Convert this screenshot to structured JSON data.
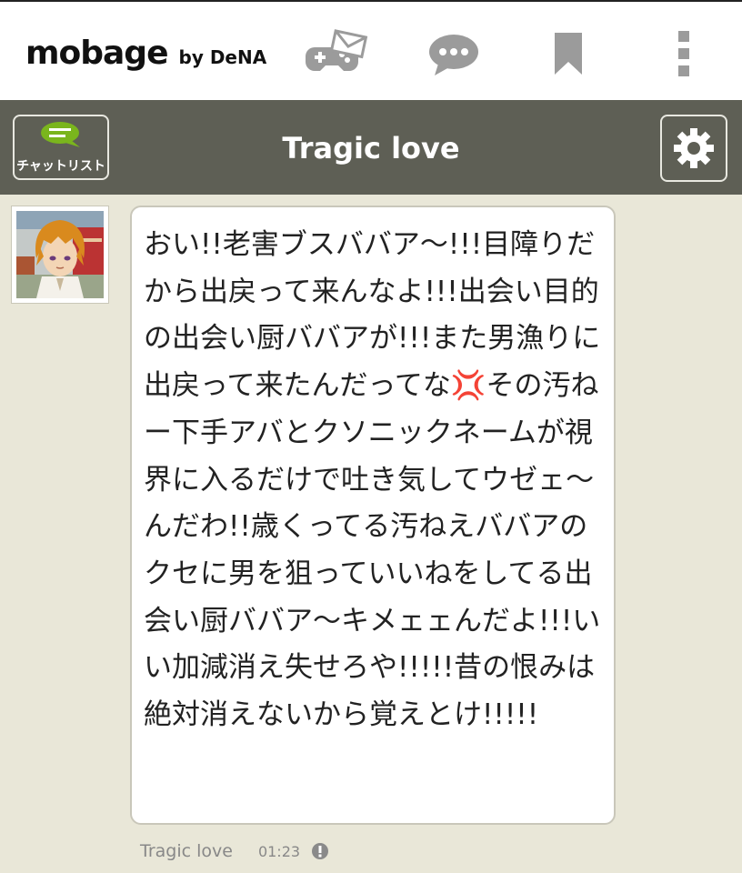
{
  "app": {
    "logo_text": "mobage",
    "logo_by": "by DeNA"
  },
  "nav": {
    "icons": [
      "game-mail-icon",
      "chat-bubble-icon",
      "bookmark-icon",
      "more-vertical-icon"
    ]
  },
  "header": {
    "chatlist_label": "チャットリスト",
    "title": "Tragic love"
  },
  "message": {
    "text": "おい!!老害ブスババア～!!!目障りだから出戻って来んなよ!!!出会い目的の出会い厨ババアが!!!また男漁りに出戻って来たんだってな💢その汚ねー下手アバとクソニックネームが視界に入るだけで吐き気してウゼェ～んだわ!!歳くってる汚ねえババアのクセに男を狙っていいねをしてる出会い厨ババア～キメェェんだよ!!!いい加減消え失せろや!!!!!昔の恨みは絶対消えないから覚えとけ!!!!!",
    "sender": "Tragic love",
    "time": "01:23"
  },
  "colors": {
    "background": "#e9e7d8",
    "header_bar": "#5e5f55",
    "chat_icon_green": "#7ab51d"
  }
}
